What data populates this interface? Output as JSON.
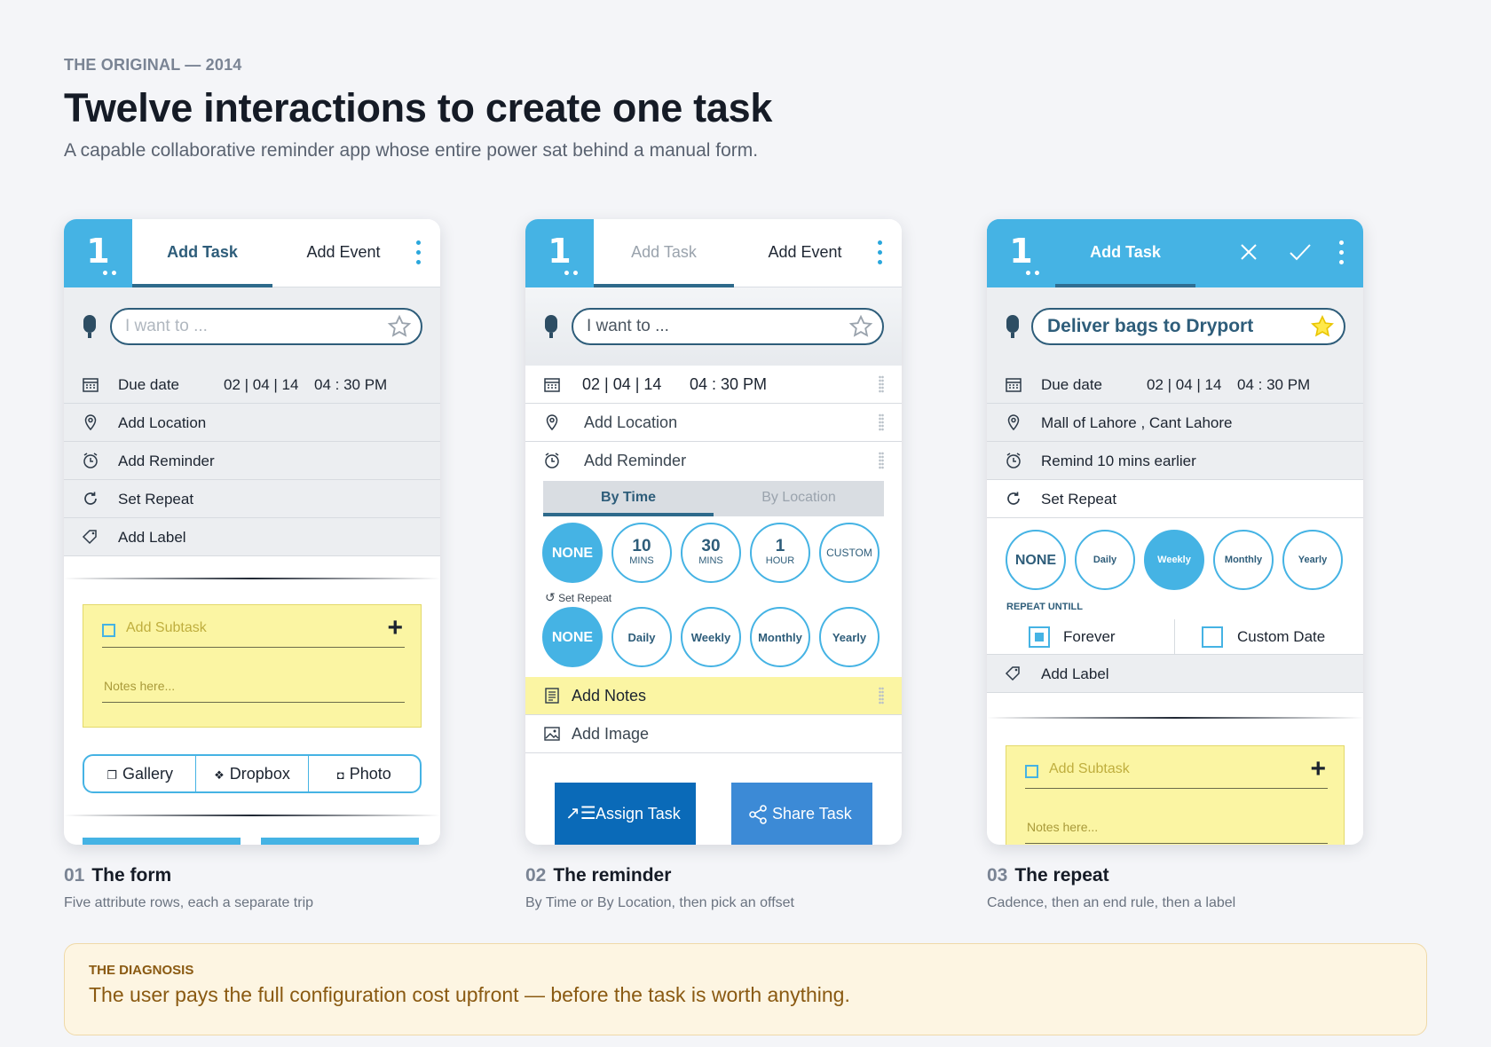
{
  "header": {
    "eyebrow": "THE ORIGINAL — 2014",
    "title": "Twelve interactions to create one task",
    "subtitle": "A capable collaborative reminder app whose entire power sat behind a manual form."
  },
  "colors": {
    "accent": "#45b3e4",
    "dark_blue": "#2e5d7a",
    "note_yellow": "#fbf5a3",
    "button_blue": "#0a6ab8",
    "diagnosis_text": "#8a5a12"
  },
  "screen1": {
    "logo": "1",
    "tabs": [
      "Add Task",
      "Add Event"
    ],
    "search_placeholder": "I want to ...",
    "rows": [
      {
        "icon": "calendar-icon",
        "label": "Due date",
        "date": "02 | 04 | 14",
        "time": "04 : 30  PM"
      },
      {
        "icon": "location-pin-icon",
        "label": "Add Location"
      },
      {
        "icon": "alarm-clock-icon",
        "label": "Add Reminder"
      },
      {
        "icon": "repeat-icon",
        "label": "Set Repeat"
      },
      {
        "icon": "tag-icon",
        "label": "Add Label"
      }
    ],
    "subtask_placeholder": "Add Subtask",
    "notes_placeholder": "Notes here...",
    "attachments": [
      "Gallery",
      "Dropbox",
      "Photo"
    ]
  },
  "screen2": {
    "logo": "1",
    "tabs": [
      "Add Task",
      "Add Event"
    ],
    "search_placeholder": "I want to ...",
    "date_row": {
      "icon": "calendar-icon",
      "date": "02 | 04 | 14",
      "time": "04 : 30  PM"
    },
    "rows": [
      {
        "icon": "location-pin-icon",
        "label": "Add Location"
      },
      {
        "icon": "alarm-clock-icon",
        "label": "Add Reminder"
      }
    ],
    "reminder_tabs": [
      "By Time",
      "By Location"
    ],
    "offsets": [
      {
        "big": "NONE",
        "small": ""
      },
      {
        "big": "10",
        "small": "MINS"
      },
      {
        "big": "30",
        "small": "MINS"
      },
      {
        "big": "1",
        "small": "HOUR"
      },
      {
        "big": "CUSTOM",
        "small": ""
      }
    ],
    "set_repeat_label": "Set Repeat",
    "repeat_options": [
      "NONE",
      "Daily",
      "Weekly",
      "Monthly",
      "Yearly"
    ],
    "notes_row": "Add Notes",
    "image_row": "Add Image",
    "buttons": [
      "Assign Task",
      "Share Task"
    ]
  },
  "screen3": {
    "logo": "1",
    "tab": "Add Task",
    "task_text": "Deliver bags to Dryport",
    "rows": [
      {
        "icon": "calendar-icon",
        "label": "Due date",
        "date": "02 | 04 | 14",
        "time": "04 : 30  PM"
      },
      {
        "icon": "location-pin-icon",
        "label": "Mall of Lahore , Cant Lahore"
      },
      {
        "icon": "alarm-clock-icon",
        "label": "Remind 10 mins earlier"
      },
      {
        "icon": "repeat-icon",
        "label": "Set Repeat"
      }
    ],
    "repeat_options": [
      "NONE",
      "Daily",
      "Weekly",
      "Monthly",
      "Yearly"
    ],
    "repeat_selected": "Weekly",
    "repeat_until_label": "REPEAT UNTILL",
    "until_options": [
      "Forever",
      "Custom Date"
    ],
    "label_row": "Add Label",
    "subtask_placeholder": "Add Subtask",
    "notes_placeholder": "Notes here..."
  },
  "captions": [
    {
      "num": "01",
      "title": "The form",
      "desc": "Five attribute rows, each a separate trip"
    },
    {
      "num": "02",
      "title": "The reminder",
      "desc": "By Time or By Location, then pick an offset"
    },
    {
      "num": "03",
      "title": "The repeat",
      "desc": "Cadence, then an end rule, then a label"
    }
  ],
  "diagnosis": {
    "label": "THE DIAGNOSIS",
    "text": "The user pays the full configuration cost upfront — before the task is worth anything."
  }
}
